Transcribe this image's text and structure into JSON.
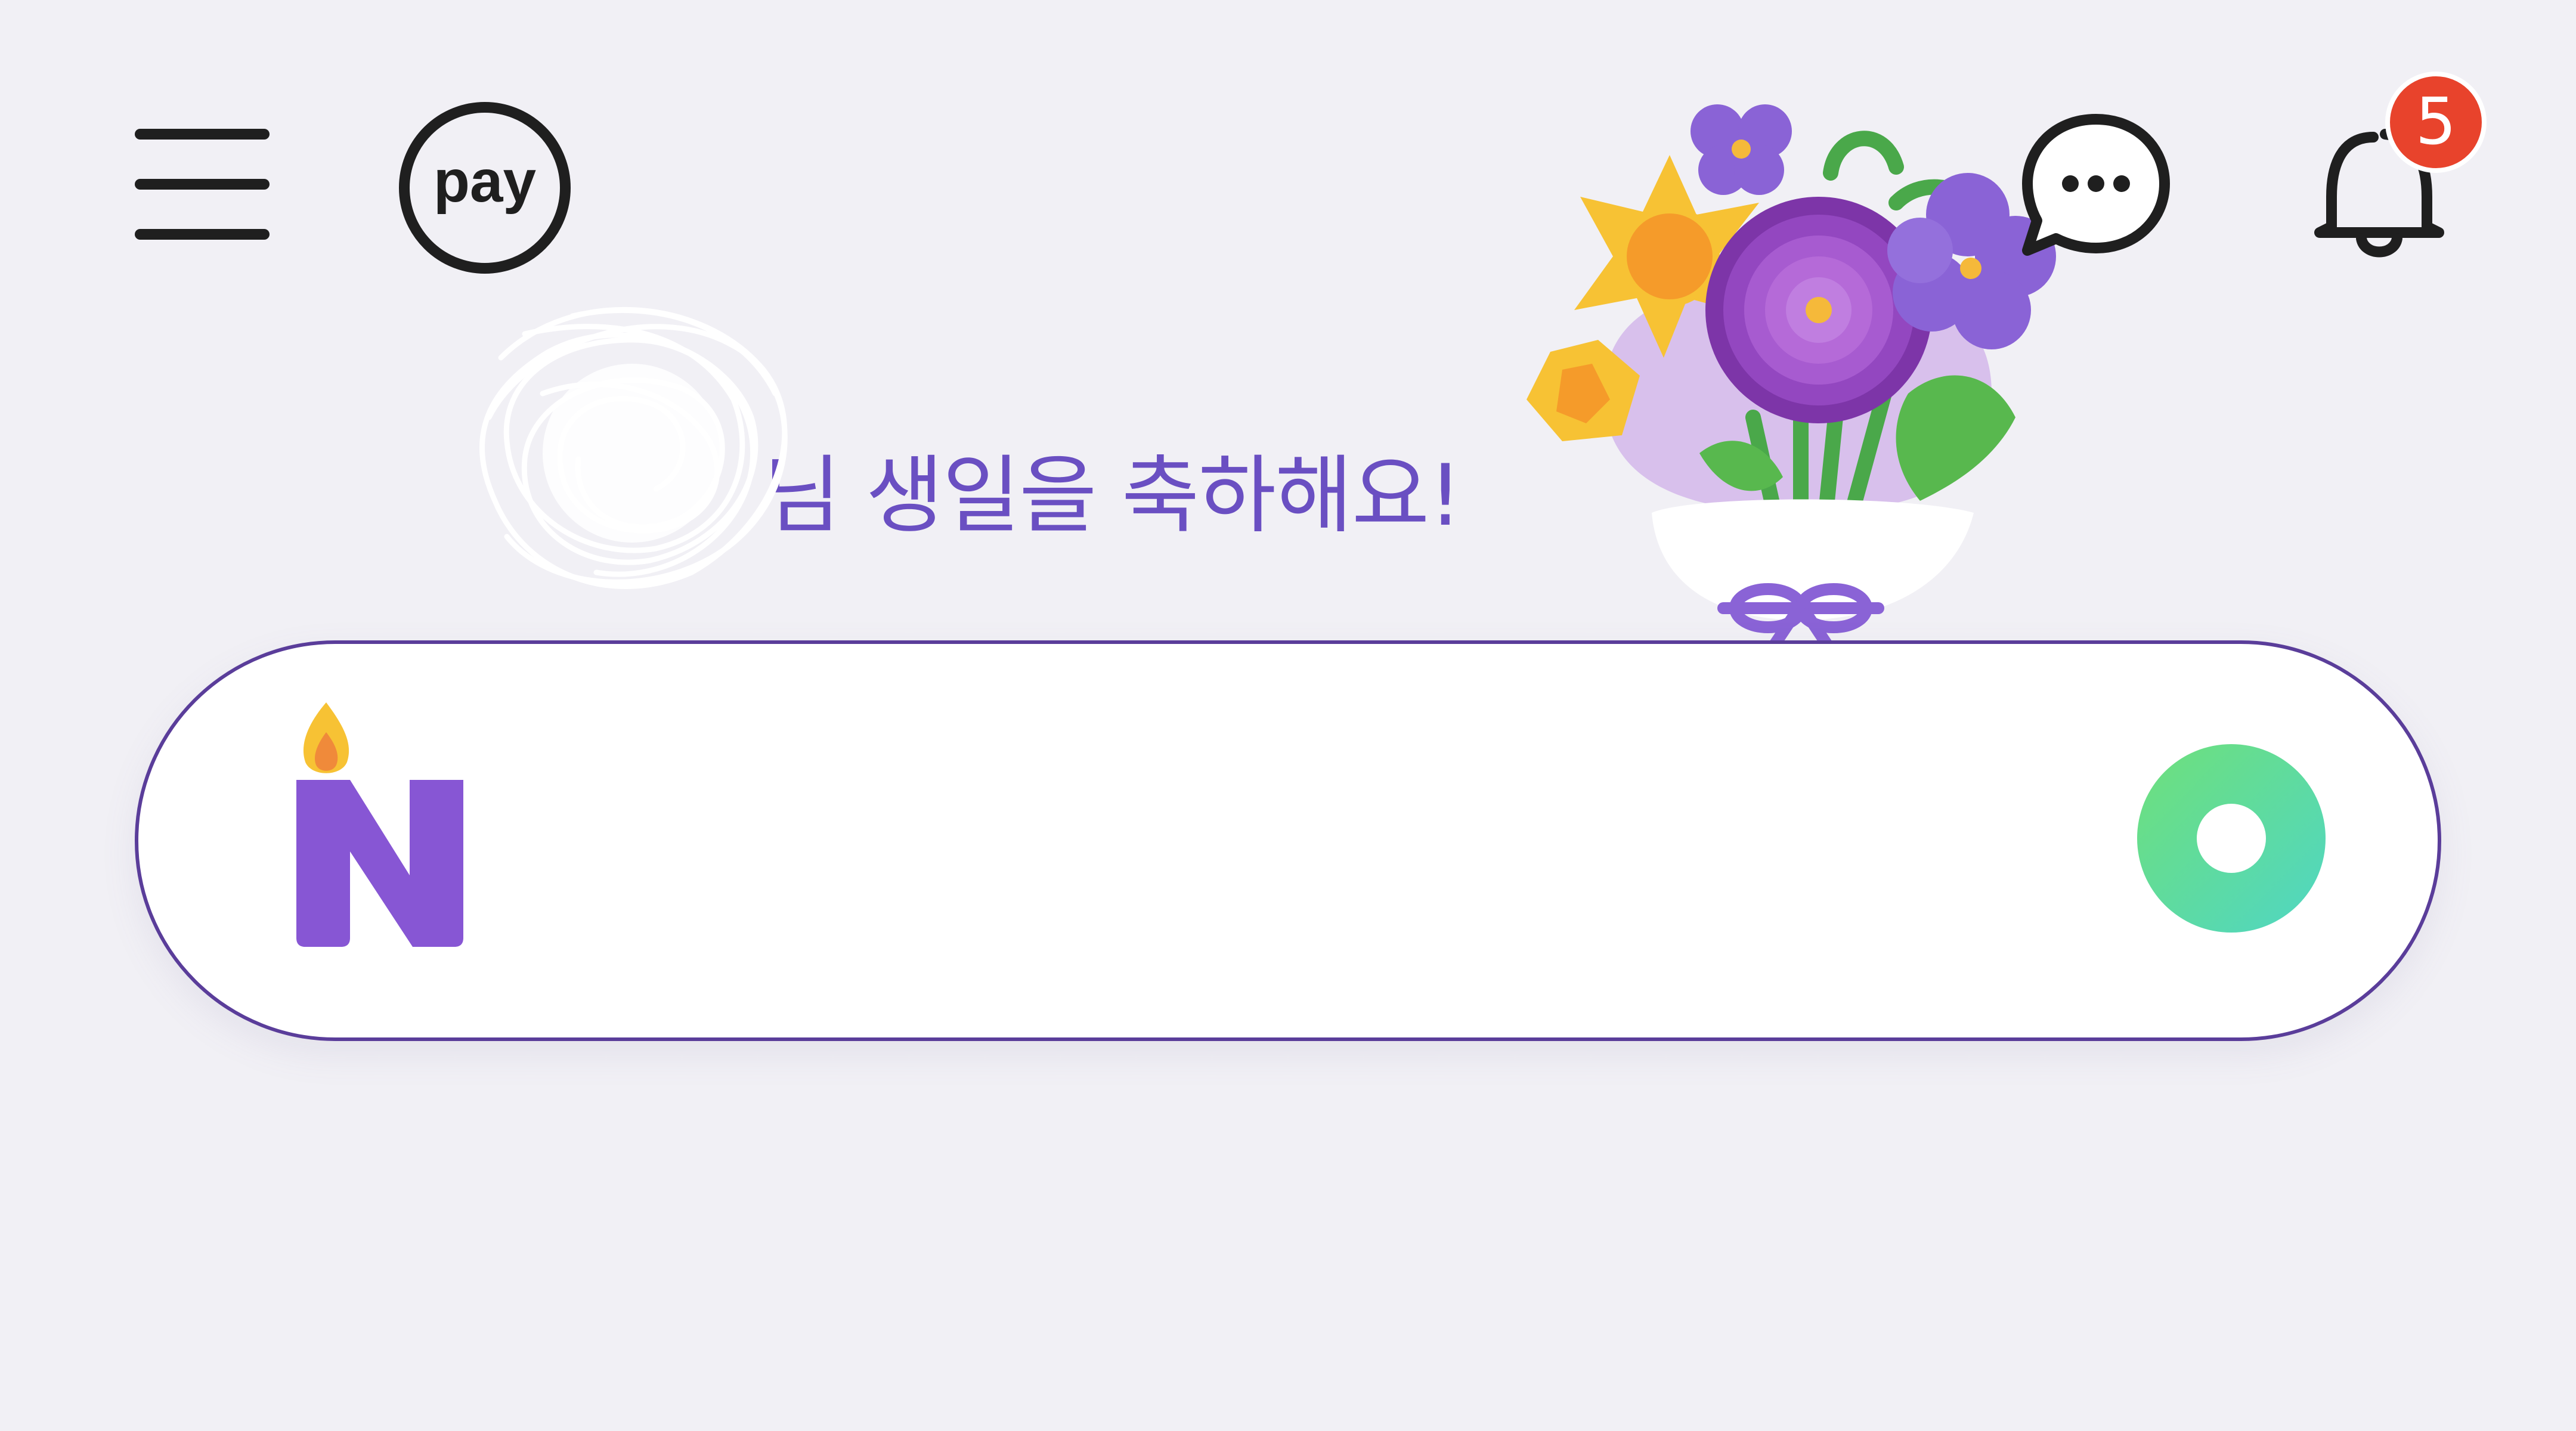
{
  "header": {
    "menu_icon": "hamburger-menu-icon",
    "pay_label": "pay",
    "chat_icon": "speech-bubble-ellipsis-icon",
    "notification_icon": "bell-icon",
    "notification_count": "5"
  },
  "greeting": {
    "text": "님 생일을 축하해요!",
    "name_obscured": true
  },
  "decoration": {
    "icon": "flower-bouquet-icon"
  },
  "search": {
    "logo_icon": "naver-n-birthday-candle-icon",
    "placeholder": "",
    "value": "",
    "green_dot_icon": "green-dot-icon"
  },
  "colors": {
    "background": "#f1f0f5",
    "accent_purple": "#6a4fc2",
    "search_border": "#5a3d9a",
    "badge_red": "#e8432c",
    "green_dot_start": "#6fe07a",
    "green_dot_end": "#4fd6c4"
  }
}
